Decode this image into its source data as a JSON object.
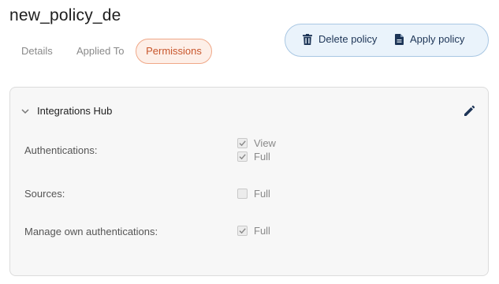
{
  "page": {
    "title": "new_policy_de"
  },
  "tabs": [
    {
      "label": "Details",
      "active": false
    },
    {
      "label": "Applied To",
      "active": false
    },
    {
      "label": "Permissions",
      "active": true
    }
  ],
  "actions": {
    "delete_label": "Delete policy",
    "delete_icon": "trash-icon",
    "apply_label": "Apply policy",
    "apply_icon": "document-icon"
  },
  "section": {
    "title": "Integrations Hub",
    "expanded": true,
    "edit_icon": "pencil-icon",
    "permissions": [
      {
        "label": "Authentications:",
        "options": [
          {
            "label": "View",
            "checked": true
          },
          {
            "label": "Full",
            "checked": true
          }
        ]
      },
      {
        "label": "Sources:",
        "options": [
          {
            "label": "Full",
            "checked": false
          }
        ]
      },
      {
        "label": "Manage own authentications:",
        "options": [
          {
            "label": "Full",
            "checked": true
          }
        ]
      }
    ]
  },
  "colors": {
    "accent": "#c8562c",
    "accent_bg": "#fdefe8",
    "actions_bg": "#eaf3fb",
    "actions_border": "#a9c7e3",
    "icon": "#1d3557"
  }
}
